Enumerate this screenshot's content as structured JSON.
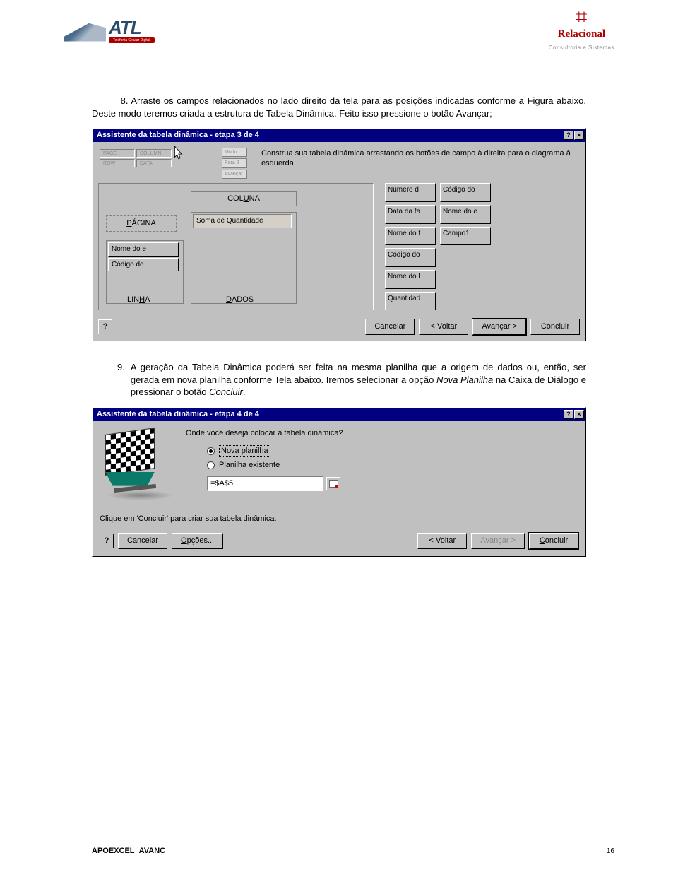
{
  "header": {
    "atl_text": "ATL",
    "atl_sub": "Telefonia Celular Digital",
    "rel_text": "Relacional",
    "rel_sub": "Consultoria e Sistemas"
  },
  "body": {
    "item8_num": "8.",
    "item8_text": "Arraste os campos relacionados no lado direito da tela para as posições indicadas conforme a Figura abaixo. Deste modo teremos criada a estrutura de Tabela Dinâmica. Feito isso pressione o botão Avançar;",
    "item9_num": "9.",
    "item9_text_a": "A geração da Tabela Dinâmica poderá ser feita na mesma planilha que a origem de dados ou, então, ser gerada em nova planilha conforme Tela abaixo. Iremos selecionar a opção ",
    "item9_italic": "Nova Planilha",
    "item9_text_b": " na Caixa de Diálogo e pressionar o botão ",
    "item9_italic2": "Concluir",
    "item9_text_c": "."
  },
  "dialog1": {
    "title": "Assistente da tabela dinâmica - etapa 3 de 4",
    "instruction": "Construa sua tabela dinâmica arrastando os botões de campo à direita para o diagrama à esquerda.",
    "zones": {
      "page": "PÁGINA",
      "column": "COLUNA",
      "row": "LINHA",
      "data": "DADOS"
    },
    "row_fields": [
      "Nome do e",
      "Código do"
    ],
    "data_fields": [
      "Soma de Quantidade"
    ],
    "available_fields": [
      "Número d",
      "Código do",
      "Data da fa",
      "Nome do e",
      "Nome do f",
      "Campo1",
      "Código do",
      "",
      "Nome do l",
      "",
      "Quantidad",
      ""
    ],
    "buttons": {
      "help": "?",
      "cancel": "Cancelar",
      "back": "< Voltar",
      "next": "Avançar >",
      "finish": "Concluir"
    },
    "mini": {
      "page": "PAGE",
      "col": "COLUMN",
      "row": "ROW",
      "data": "DATA",
      "b1": "Modo",
      "b2": "Para 2",
      "b3": "Avançar"
    }
  },
  "dialog2": {
    "title": "Assistente da tabela dinâmica - etapa 4 de 4",
    "prompt": "Onde você deseja colocar a tabela dinâmica?",
    "opt_new": "Nova planilha",
    "opt_existing": "Planilha existente",
    "ref_value": "=$A$5",
    "hint": "Clique em 'Concluir' para criar sua tabela dinâmica.",
    "buttons": {
      "help": "?",
      "cancel": "Cancelar",
      "options": "Opções...",
      "back": "< Voltar",
      "next": "Avançar >",
      "finish": "Concluir"
    }
  },
  "footer": {
    "doc": "APOEXCEL_AVANC",
    "page": "16"
  }
}
